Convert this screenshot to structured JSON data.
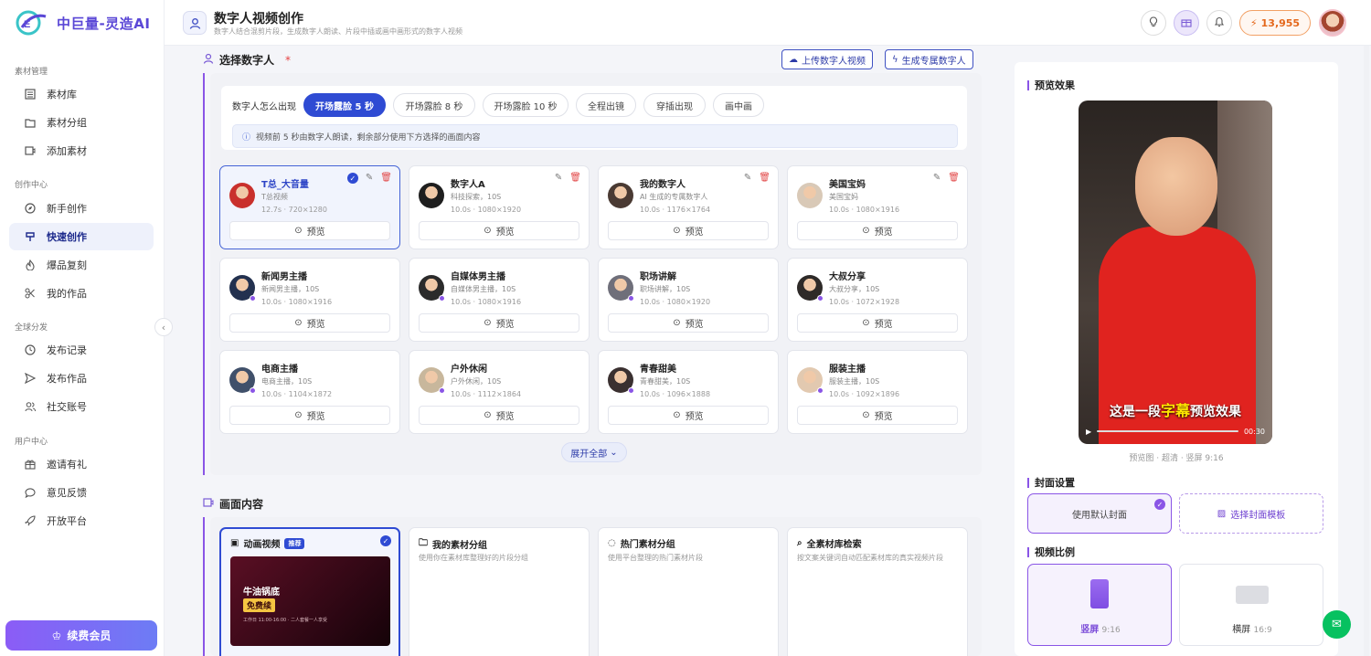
{
  "brand": {
    "name": "中巨量-灵造AI"
  },
  "sidebar": {
    "sections": [
      {
        "title": "素材管理",
        "items": [
          "素材库",
          "素材分组",
          "添加素材"
        ]
      },
      {
        "title": "创作中心",
        "items": [
          "新手创作",
          "快速创作",
          "爆品复刻",
          "我的作品"
        ]
      },
      {
        "title": "全球分发",
        "items": [
          "发布记录",
          "发布作品",
          "社交账号"
        ]
      },
      {
        "title": "用户中心",
        "items": [
          "邀请有礼",
          "意见反馈",
          "开放平台"
        ]
      }
    ],
    "active_item": "快速创作",
    "vip_label": "续费会员"
  },
  "header": {
    "title": "数字人视频创作",
    "subtitle": "数字人结合混剪片段，生成数字人朗读、片段中插或画中画形式的数字人视频",
    "credits": "13,955"
  },
  "select_section": {
    "title": "选择数字人",
    "required_mark": "*",
    "upload_btn": "上传数字人视频",
    "generate_btn": "生成专属数字人",
    "how_label": "数字人怎么出现",
    "chips": [
      "开场露脸 5 秒",
      "开场露脸 8 秒",
      "开场露脸 10 秒",
      "全程出镜",
      "穿插出现",
      "画中画"
    ],
    "active_chip": 0,
    "info": "视频前 5 秒由数字人朗读，剩余部分使用下方选择的画面内容",
    "preview_label": "预览",
    "expand_label": "展开全部",
    "avatars": [
      {
        "name": "T总_大音量",
        "desc": "T总视频",
        "meta": "12.7s · 720×1280",
        "selected": true,
        "editable": true
      },
      {
        "name": "数字人A",
        "desc": "科技探索，10S",
        "meta": "10.0s · 1080×1920",
        "editable": true
      },
      {
        "name": "我的数字人",
        "desc": "AI 生成的专属数字人",
        "meta": "10.0s · 1176×1764",
        "editable": true
      },
      {
        "name": "美国宝妈",
        "desc": "美国宝妈",
        "meta": "10.0s · 1080×1916",
        "editable": true
      },
      {
        "name": "新闻男主播",
        "desc": "新闻男主播，10S",
        "meta": "10.0s · 1080×1916"
      },
      {
        "name": "自媒体男主播",
        "desc": "自媒体男主播，10S",
        "meta": "10.0s · 1080×1916"
      },
      {
        "name": "职场讲解",
        "desc": "职场讲解，10S",
        "meta": "10.0s · 1080×1920"
      },
      {
        "name": "大叔分享",
        "desc": "大叔分享，10S",
        "meta": "10.0s · 1072×1928"
      },
      {
        "name": "电商主播",
        "desc": "电商主播，10S",
        "meta": "10.0s · 1104×1872"
      },
      {
        "name": "户外休闲",
        "desc": "户外休闲，10S",
        "meta": "10.0s · 1112×1864"
      },
      {
        "name": "青春甜美",
        "desc": "青春甜美，10S",
        "meta": "10.0s · 1096×1888"
      },
      {
        "name": "服装主播",
        "desc": "服装主播，10S",
        "meta": "10.0s · 1092×1896"
      }
    ]
  },
  "content_section": {
    "title": "画面内容",
    "cards": [
      {
        "title": "动画视频",
        "badge": "推荐",
        "selected": true,
        "thumb_line1": "牛油锅底",
        "thumb_line2": "免费续",
        "thumb_small": "工作日 11:00-16:00 · 二人套餐一人享受"
      },
      {
        "title": "我的素材分组",
        "desc": "使用你在素材库整理好的片段分组"
      },
      {
        "title": "热门素材分组",
        "desc": "使用平台整理的热门素材片段"
      },
      {
        "title": "全素材库检索",
        "desc": "按文案关键词自动匹配素材库的真实视频片段"
      }
    ]
  },
  "preview": {
    "title": "预览效果",
    "caption_pre": "这是一段",
    "caption_hl": "字幕",
    "caption_post": "预览效果",
    "time": "00:30",
    "meta": "预览图 · 超清 · 竖屏 9:16"
  },
  "cover": {
    "title": "封面设置",
    "default": "使用默认封面",
    "template": "选择封面模板"
  },
  "ratio": {
    "title": "视频比例",
    "portrait": "竖屏",
    "portrait_ratio": "9:16",
    "landscape": "横屏",
    "landscape_ratio": "16:9"
  },
  "colors": {
    "accent": "#2f4bd3",
    "purple": "#8a55e6",
    "danger": "#e24a4a",
    "coin": "#e4681c"
  }
}
